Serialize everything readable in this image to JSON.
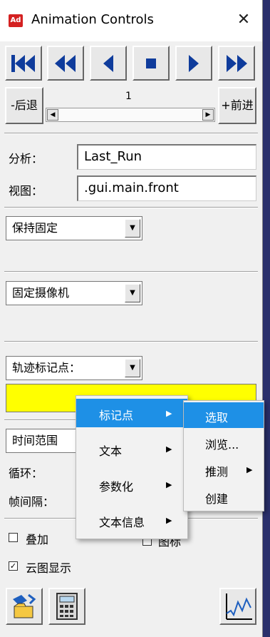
{
  "window": {
    "title": "Animation Controls",
    "app_icon_text": "Ad",
    "close_glyph": "✕"
  },
  "transport": {
    "buttons": [
      "rewind-to-start-icon",
      "step-back-icon",
      "play-backward-icon",
      "stop-icon",
      "play-forward-icon",
      "fast-forward-icon"
    ]
  },
  "frame": {
    "back_label": "-后退",
    "forward_label": "+前进",
    "current_frame": "1"
  },
  "analysis": {
    "analysis_label": "分析：",
    "analysis_value": "Last_Run",
    "view_label": "视图：",
    "view_value": ".gui.main.front"
  },
  "dropdowns": {
    "hold_mode": "保持固定",
    "camera_mode": "固定摄像机",
    "trace_marker": "轨迹标记点："
  },
  "range": {
    "time_range": "时间范围",
    "loop_label": "循环：",
    "frame_interval_label": "帧间隔："
  },
  "options": {
    "overlay_label": "叠加",
    "overlay_checked": false,
    "contour_label": "云图显示",
    "contour_checked": true,
    "icon_label_partial": "图标",
    "check_glyph": "✓"
  },
  "context_menu": {
    "items": [
      {
        "label": "标记点",
        "submenu": true,
        "highlighted": true
      },
      {
        "label": "文本",
        "submenu": true,
        "highlighted": false
      },
      {
        "label": "参数化",
        "submenu": true,
        "highlighted": false
      },
      {
        "label": "文本信息",
        "submenu": true,
        "highlighted": false
      }
    ],
    "submenu_arrow": "▶"
  },
  "submenu": {
    "items": [
      {
        "label": "选取",
        "submenu": false,
        "highlighted": true
      },
      {
        "label": "浏览...",
        "submenu": false,
        "highlighted": false
      },
      {
        "label": "推测",
        "submenu": true,
        "highlighted": false
      },
      {
        "label": "创建",
        "submenu": false,
        "highlighted": false
      }
    ]
  },
  "colors": {
    "highlight": "#1e90e6",
    "trace_color": "#ffff00",
    "background": "#f0f0f0",
    "icon_blue": "#0f3c9c"
  },
  "bottom_tools": [
    "load-animation-icon",
    "calculator-icon",
    "plot-icon"
  ]
}
